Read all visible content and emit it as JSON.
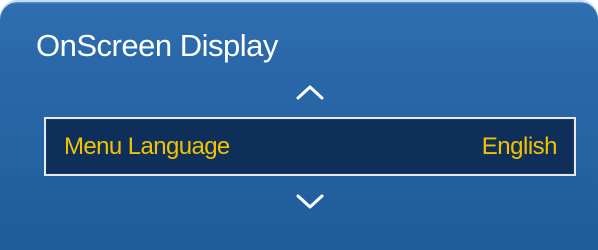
{
  "panel": {
    "title": "OnScreen Display"
  },
  "menu": {
    "item": {
      "label": "Menu Language",
      "value": "English"
    },
    "up_icon": "chevron-up-icon",
    "down_icon": "chevron-down-icon"
  },
  "colors": {
    "panel_blue": "#2a68a9",
    "highlight_bg": "#0d2f59",
    "highlight_text": "#f2c200",
    "title_text": "#ffffff"
  }
}
